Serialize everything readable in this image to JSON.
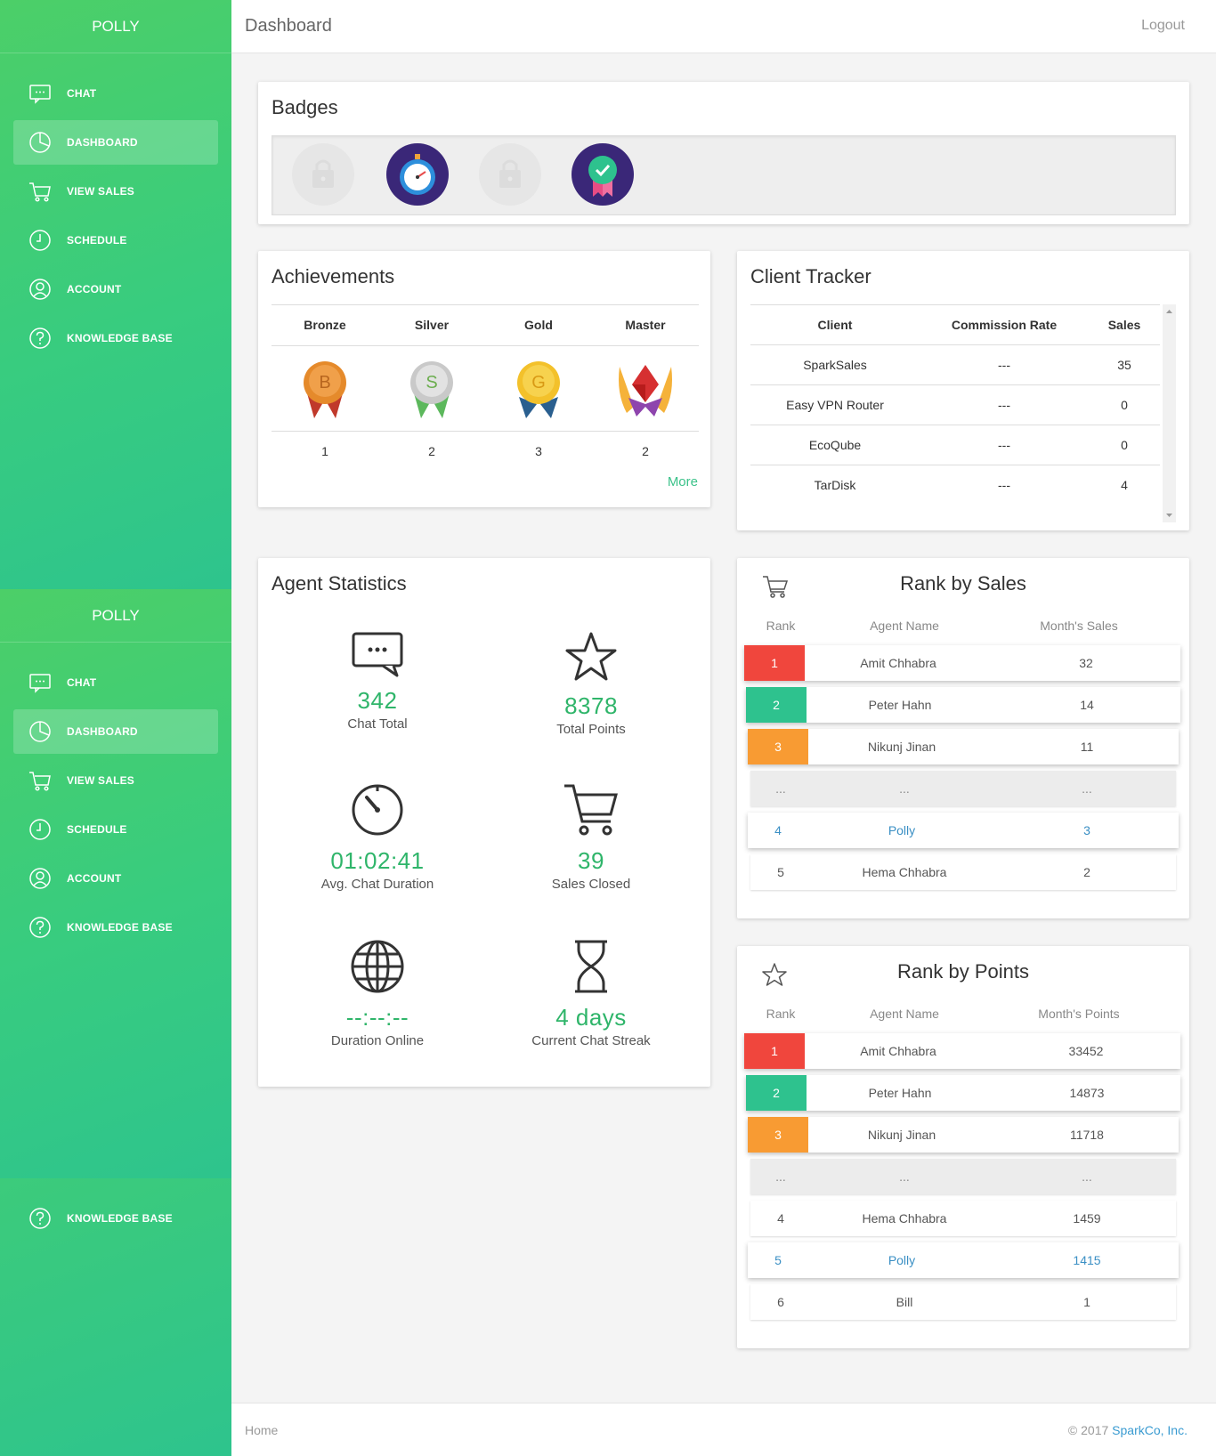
{
  "sidebar": {
    "brand": "POLLY",
    "items": [
      {
        "label": "CHAT",
        "icon": "chat-icon"
      },
      {
        "label": "DASHBOARD",
        "icon": "pie-chart-icon",
        "active": true
      },
      {
        "label": "VIEW SALES",
        "icon": "cart-icon"
      },
      {
        "label": "SCHEDULE",
        "icon": "clock-icon"
      },
      {
        "label": "ACCOUNT",
        "icon": "user-icon"
      },
      {
        "label": "KNOWLEDGE BASE",
        "icon": "help-icon"
      }
    ]
  },
  "topbar": {
    "title": "Dashboard",
    "logout": "Logout"
  },
  "badges": {
    "title": "Badges",
    "items": [
      {
        "icon": "locked-badge-icon",
        "locked": true
      },
      {
        "icon": "stopwatch-badge-icon",
        "locked": false
      },
      {
        "icon": "locked-badge-icon",
        "locked": true
      },
      {
        "icon": "ribbon-check-badge-icon",
        "locked": false
      }
    ]
  },
  "achievements": {
    "title": "Achievements",
    "columns": [
      "Bronze",
      "Silver",
      "Gold",
      "Master"
    ],
    "medal_letters": [
      "B",
      "S",
      "G"
    ],
    "counts": [
      "1",
      "2",
      "3",
      "2"
    ],
    "more": "More"
  },
  "client_tracker": {
    "title": "Client Tracker",
    "headers": [
      "Client",
      "Commission Rate",
      "Sales"
    ],
    "rows": [
      [
        "SparkSales",
        "---",
        "35"
      ],
      [
        "Easy VPN Router",
        "---",
        "0"
      ],
      [
        "EcoQube",
        "---",
        "0"
      ],
      [
        "TarDisk",
        "---",
        "4"
      ]
    ]
  },
  "agent_stats": {
    "title": "Agent Statistics",
    "items": [
      {
        "value": "342",
        "label": "Chat Total",
        "icon": "chat-bubble-icon"
      },
      {
        "value": "8378",
        "label": "Total Points",
        "icon": "star-icon"
      },
      {
        "value": "01:02:41",
        "label": "Avg. Chat Duration",
        "icon": "stopwatch-icon"
      },
      {
        "value": "39",
        "label": "Sales Closed",
        "icon": "cart-icon"
      },
      {
        "value": "--:--:--",
        "label": "Duration Online",
        "icon": "globe-icon"
      },
      {
        "value": "4 days",
        "label": "Current Chat Streak",
        "icon": "hourglass-icon"
      }
    ]
  },
  "rank_sales": {
    "title": "Rank by Sales",
    "headers": [
      "Rank",
      "Agent Name",
      "Month's Sales"
    ],
    "rows": [
      [
        "1",
        "Amit Chhabra",
        "32"
      ],
      [
        "2",
        "Peter Hahn",
        "14"
      ],
      [
        "3",
        "Nikunj Jinan",
        "11"
      ],
      [
        "...",
        "...",
        "..."
      ],
      [
        "4",
        "Polly",
        "3"
      ],
      [
        "5",
        "Hema Chhabra",
        "2"
      ]
    ]
  },
  "rank_points": {
    "title": "Rank by Points",
    "headers": [
      "Rank",
      "Agent Name",
      "Month's Points"
    ],
    "rows": [
      [
        "1",
        "Amit Chhabra",
        "33452"
      ],
      [
        "2",
        "Peter Hahn",
        "14873"
      ],
      [
        "3",
        "Nikunj Jinan",
        "11718"
      ],
      [
        "...",
        "...",
        "..."
      ],
      [
        "4",
        "Hema Chhabra",
        "1459"
      ],
      [
        "5",
        "Polly",
        "1415"
      ],
      [
        "6",
        "Bill",
        "1"
      ]
    ]
  },
  "footer": {
    "home": "Home",
    "copyright": "© 2017 ",
    "company": "SparkCo, Inc."
  },
  "colors": {
    "accent": "#2fb56a",
    "rank1": "#f0463d",
    "rank2": "#2ec28e",
    "rank3": "#f89b33",
    "link": "#3a8fc4"
  }
}
